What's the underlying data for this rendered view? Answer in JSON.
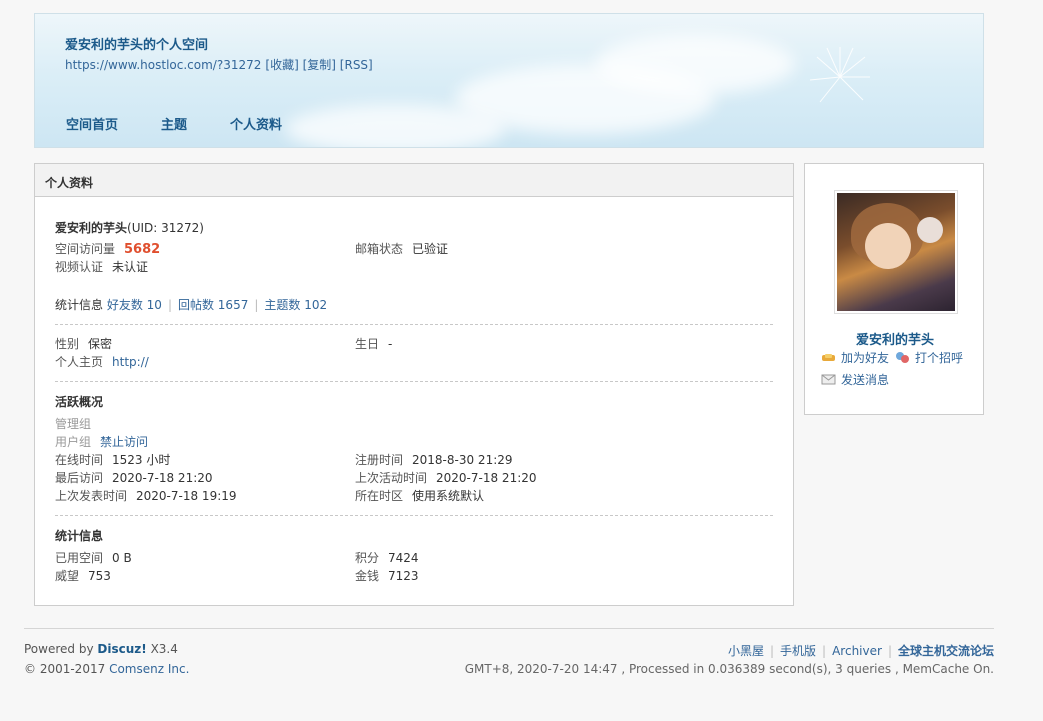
{
  "header": {
    "title": "爱安利的芋头的个人空间",
    "url": "https://www.hostloc.com/?31272",
    "actions": [
      "[收藏]",
      "[复制]",
      "[RSS]"
    ],
    "nav": [
      "空间首页",
      "主题",
      "个人资料"
    ]
  },
  "profile": {
    "panel_title": "个人资料",
    "username": "爱安利的芋头",
    "uid": "(UID: 31272)",
    "visits_label": "空间访问量",
    "visits_value": "5682",
    "email_label": "邮箱状态",
    "email_value": "已验证",
    "video_label": "视频认证",
    "video_value": "未认证",
    "stats_label": "统计信息",
    "stats_links": [
      "好友数 10",
      "回帖数 1657",
      "主题数 102"
    ],
    "gender_label": "性别",
    "gender_value": "保密",
    "birthday_label": "生日",
    "birthday_value": "-",
    "homepage_label": "个人主页",
    "homepage_value": "http://",
    "activity_title": "活跃概况",
    "admin_group_label": "管理组",
    "user_group_label": "用户组",
    "user_group_value": "禁止访问",
    "online_label": "在线时间",
    "online_value": "1523 小时",
    "register_label": "注册时间",
    "register_value": "2018-8-30 21:29",
    "last_visit_label": "最后访问",
    "last_visit_value": "2020-7-18 21:20",
    "last_active_label": "上次活动时间",
    "last_active_value": "2020-7-18 21:20",
    "last_post_label": "上次发表时间",
    "last_post_value": "2020-7-18 19:19",
    "timezone_label": "所在时区",
    "timezone_value": "使用系统默认",
    "stats_title": "统计信息",
    "space_label": "已用空间",
    "space_value": "0 B",
    "points_label": "积分",
    "points_value": "7424",
    "prestige_label": "威望",
    "prestige_value": "753",
    "money_label": "金钱",
    "money_value": "7123"
  },
  "side": {
    "name": "爱安利的芋头",
    "add_friend": "加为好友",
    "greet": "打个招呼",
    "message": "发送消息"
  },
  "footer": {
    "powered_by": "Powered by",
    "product": "Discuz!",
    "version": "X3.4",
    "copyright": "© 2001-2017",
    "company": "Comsenz Inc.",
    "links": [
      "小黑屋",
      "手机版",
      "Archiver",
      "全球主机交流论坛"
    ],
    "info": "GMT+8, 2020-7-20 14:47 , Processed in 0.036389 second(s), 3 queries , MemCache On."
  }
}
